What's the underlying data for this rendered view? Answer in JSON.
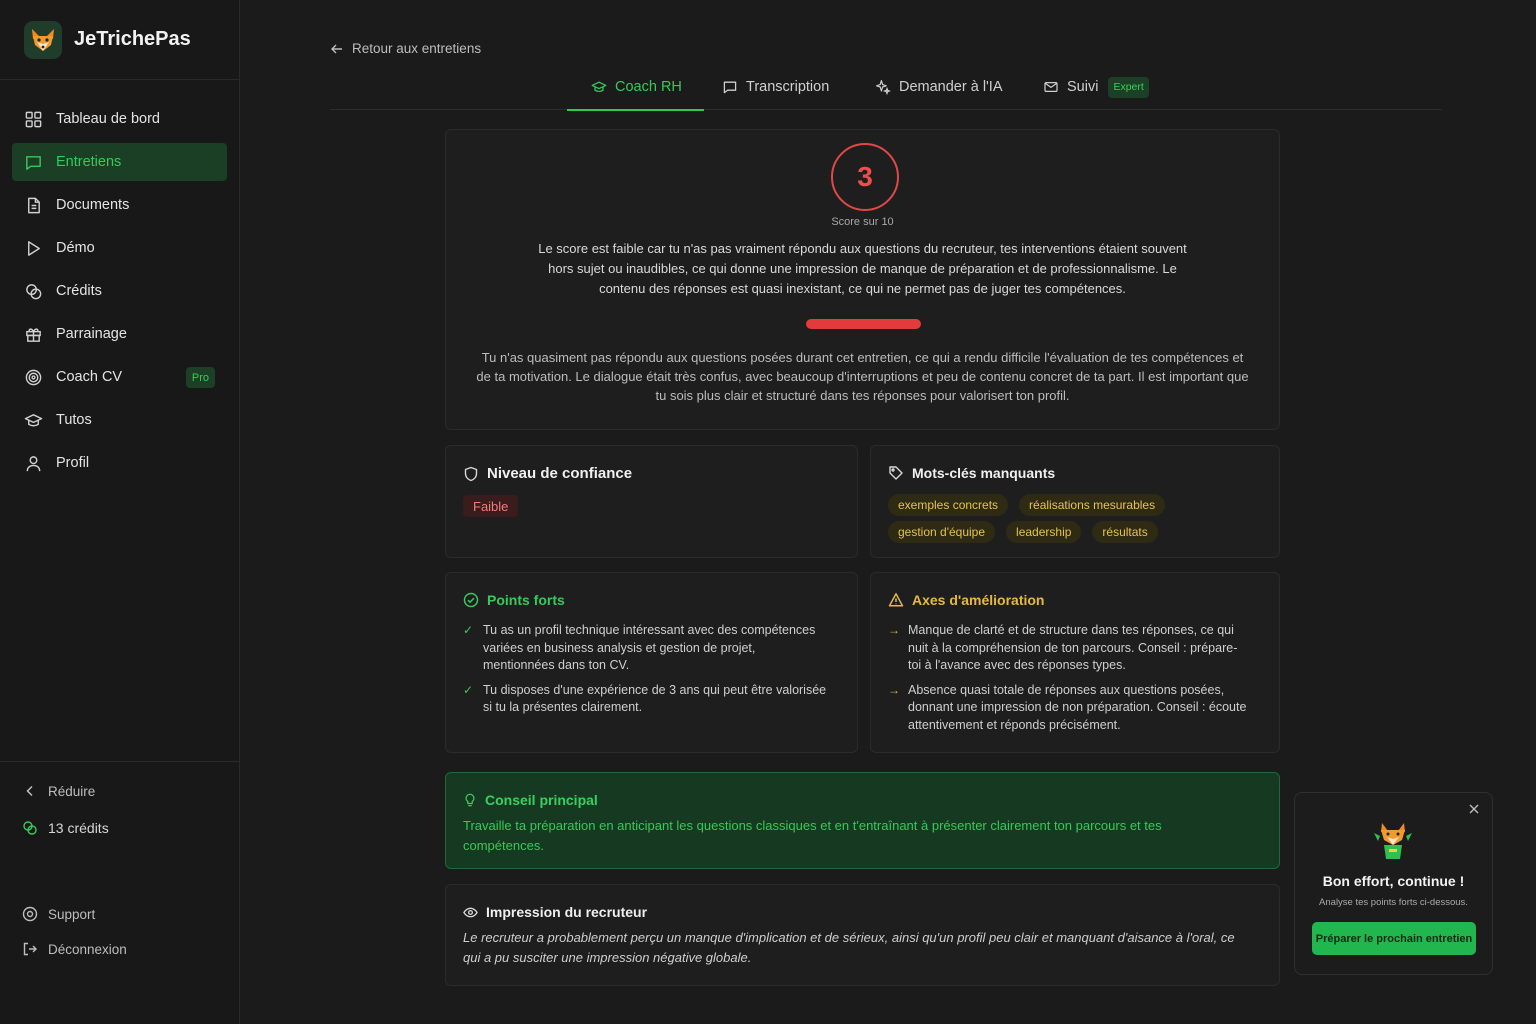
{
  "app": {
    "name": "JeTrichePas"
  },
  "sidebar": {
    "items": [
      {
        "label": "Tableau de bord",
        "icon": "grid-icon"
      },
      {
        "label": "Entretiens",
        "icon": "chat-icon",
        "active": true
      },
      {
        "label": "Documents",
        "icon": "document-icon"
      },
      {
        "label": "Démo",
        "icon": "play-icon"
      },
      {
        "label": "Crédits",
        "icon": "coins-icon"
      },
      {
        "label": "Parrainage",
        "icon": "gift-icon"
      },
      {
        "label": "Coach CV",
        "icon": "target-icon",
        "badge": "Pro"
      },
      {
        "label": "Tutos",
        "icon": "graduation-cap-icon"
      },
      {
        "label": "Profil",
        "icon": "user-icon"
      }
    ],
    "collapse_label": "Réduire",
    "credits_label": "13 crédits",
    "support_label": "Support",
    "logout_label": "Déconnexion"
  },
  "header": {
    "back_label": "Retour aux entretiens",
    "tabs": [
      {
        "label": "Coach RH",
        "icon": "graduation-cap-icon",
        "active": true
      },
      {
        "label": "Transcription",
        "icon": "chat-icon"
      },
      {
        "label": "Demander à l'IA",
        "icon": "sparkles-icon"
      },
      {
        "label": "Suivi",
        "icon": "mail-icon",
        "badge": "Expert"
      }
    ]
  },
  "score": {
    "value": "3",
    "label": "Score sur 10",
    "explanation": "Le score est faible car tu n'as pas vraiment répondu aux questions du recruteur, tes interventions étaient souvent hors sujet ou inaudibles, ce qui donne une impression de manque de préparation et de professionnali­sme. Le contenu des réponses est quasi inexistant, ce qui ne permet pas de juger tes compétences.",
    "summary": "Tu n'as quasiment pas répondu aux questions posées durant cet entretien, ce qui a rendu difficile l'évaluation de tes compétences et de ta motivation. Le dialogue était très confus, avec beaucoup d'interruptions et peu de contenu conc­ret de ta part. Il est important que tu sois plus clair et structuré dans tes réponses pour valorisert ton profil."
  },
  "confidence": {
    "title": "Niveau de confiance",
    "level": "Faible"
  },
  "keywords": {
    "title": "Mots-clés manquants",
    "items": [
      "exemples concrets",
      "réalisations mesurables",
      "gestion d'équipe",
      "leadership",
      "résultats"
    ]
  },
  "strengths": {
    "title": "Points forts",
    "items": [
      "Tu as un profil technique intéressant avec des compétences variées en business analysis et gestion de projet, mentionnées dans ton CV.",
      "Tu disposes d'une expérience de 3 ans qui peut être valorisée si tu la présentes clairement."
    ]
  },
  "improvements": {
    "title": "Axes d'amélioration",
    "items": [
      "Manque de clarté et de structure dans tes réponses, ce qui nuit à la compréhension de ton parcours. Conseil : prépare-toi à l'avance avec des réponses types.",
      "Absence quasi totale de réponses aux questions posées, donnant une impression de non préparation. Conseil : écoute attentivement et réponds précisément."
    ]
  },
  "advice": {
    "title": "Conseil principal",
    "text": "Travaille ta préparation en anticipant les questions classiques et en t'entraînant à présenter clairement ton parcours et tes compétences."
  },
  "impression": {
    "title": "Impression du recruteur",
    "text": "Le recruteur a probablement perçu un manque d'implication et de sérieux, ainsi qu'un profil peu clair et manquant d'aisance à l'oral, ce qui a pu susciter une impression négative globale."
  },
  "toast": {
    "title": "Bon effort, continue !",
    "subtitle": "Analyse tes points forts ci-dessous.",
    "button": "Préparer le prochain entretien"
  },
  "colors": {
    "accent_green": "#2fc755",
    "score_red": "#e04848",
    "keyword_amber": "#e7c34a",
    "background": "#1b1b1b"
  }
}
